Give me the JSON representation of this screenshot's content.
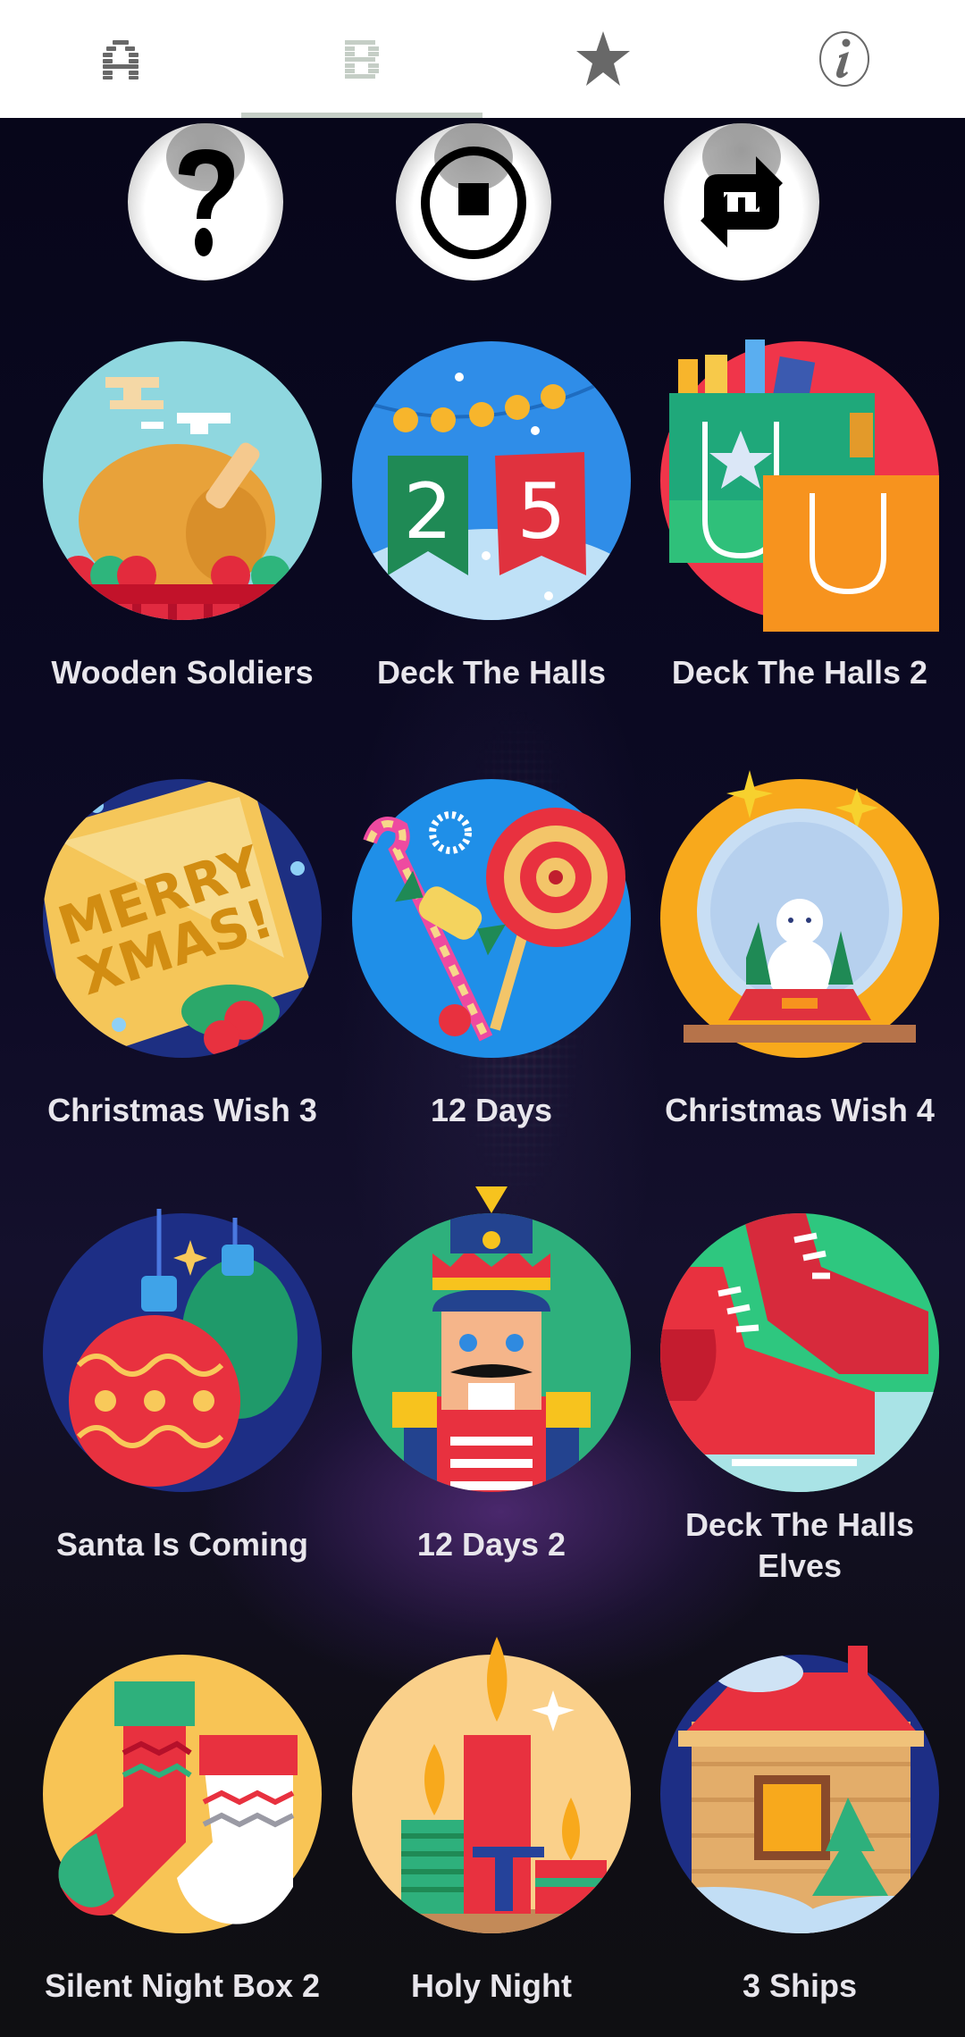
{
  "tabs": [
    {
      "name": "alphabet",
      "icon": "letter-a-icon",
      "active": false
    },
    {
      "name": "list",
      "icon": "letter-b-icon",
      "active": true
    },
    {
      "name": "favorites",
      "icon": "star-icon",
      "active": false
    },
    {
      "name": "info",
      "icon": "info-icon",
      "active": false
    }
  ],
  "colors": {
    "tab_icon": "#686868",
    "tab_icon_active": "#c5cec6",
    "label_text": "#e8e6ec",
    "background": "#07051a"
  },
  "controls": [
    {
      "name": "help",
      "icon": "question-mark-icon"
    },
    {
      "name": "stop",
      "icon": "stop-icon"
    },
    {
      "name": "repeat",
      "icon": "repeat-icon"
    }
  ],
  "songs": [
    {
      "title": "Wooden Soldiers",
      "icon": "turkey-dinner-icon"
    },
    {
      "title": "Deck The Halls",
      "icon": "calendar-25-icon",
      "badge_left": "2",
      "badge_right": "5"
    },
    {
      "title": "Deck The Halls 2",
      "icon": "shopping-bags-icon"
    },
    {
      "title": "Christmas Wish 3",
      "icon": "merry-xmas-card-icon",
      "card_line1": "MERRY",
      "card_line2": "XMAS!"
    },
    {
      "title": "12 Days",
      "icon": "candy-lollipop-icon"
    },
    {
      "title": "Christmas Wish 4",
      "icon": "snow-globe-icon"
    },
    {
      "title": "Santa Is Coming",
      "icon": "ornaments-icon"
    },
    {
      "title": "12 Days 2",
      "icon": "nutcracker-icon"
    },
    {
      "title": "Deck The Halls Elves",
      "icon": "ice-skates-icon"
    },
    {
      "title": "Silent Night Box 2",
      "icon": "stockings-icon"
    },
    {
      "title": "Holy Night",
      "icon": "candles-icon"
    },
    {
      "title": "3 Ships",
      "icon": "cabin-icon"
    }
  ]
}
